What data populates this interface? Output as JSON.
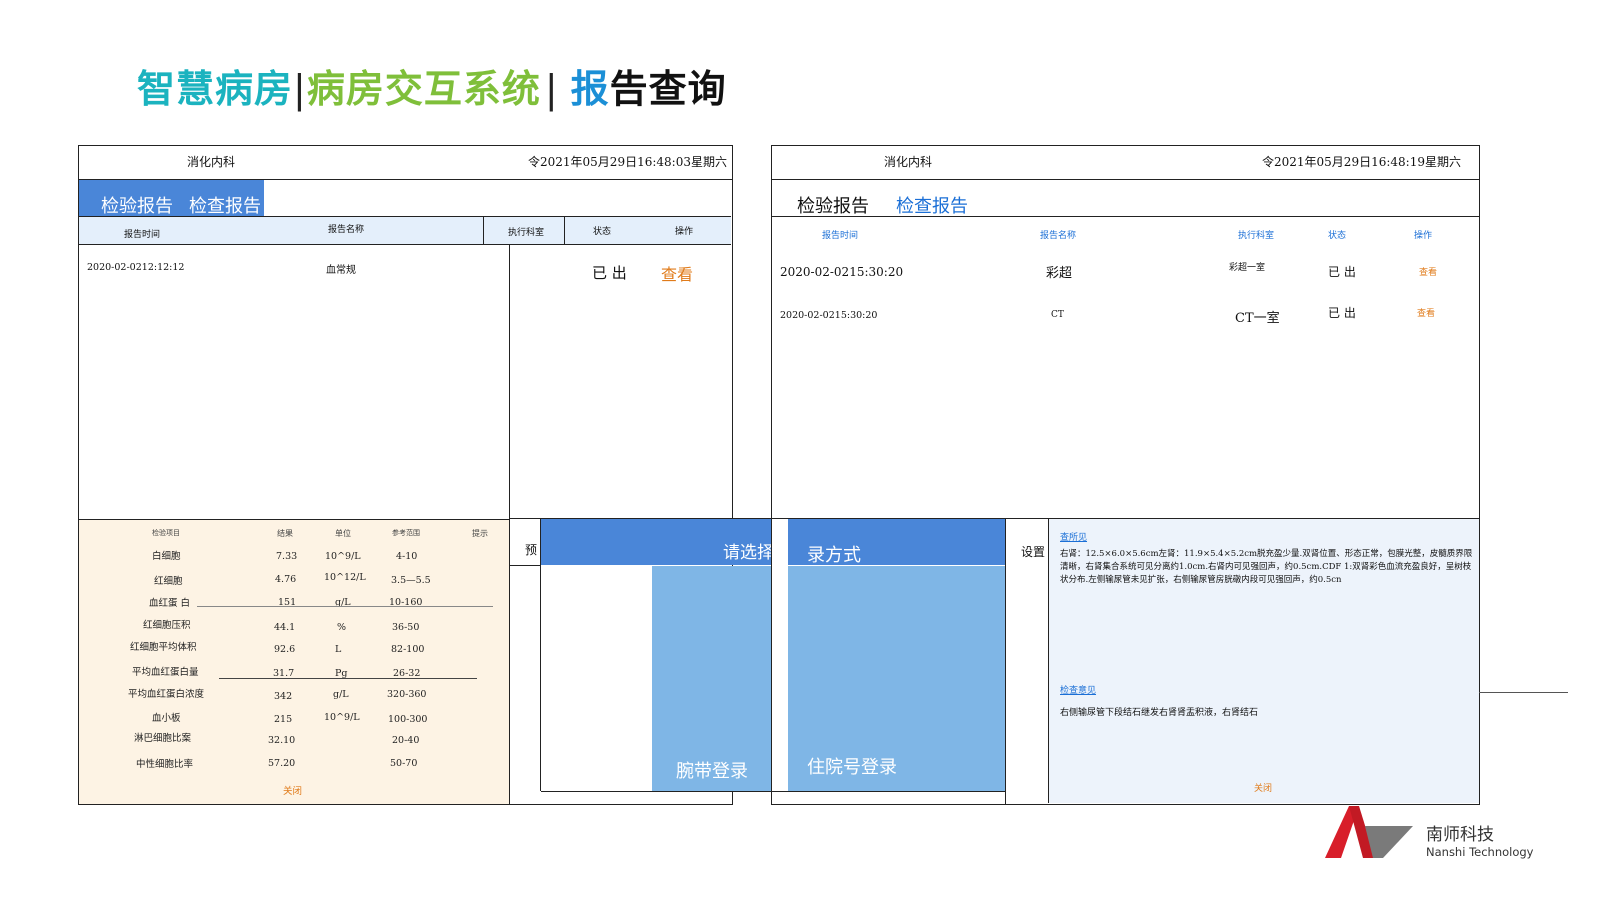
{
  "page_title": {
    "part1": "智慧病房",
    "sep1": "|",
    "part2": "病房交互系统",
    "sep2": "|",
    "part3a": "报",
    "part3b": "告查询"
  },
  "left_panel": {
    "department": "消化内科",
    "datetime": "令2021年05月29日16:48:03星期六",
    "tabs": {
      "tab1": "检验报告",
      "tab2": "检查报告"
    },
    "columns": {
      "time": "报告时间",
      "name": "报告名称",
      "dept": "执行科室",
      "status": "状态",
      "action": "操作"
    },
    "row": {
      "time": "2020-02-0212:12:12",
      "name": "血常规",
      "status": "已 出",
      "action": "查看"
    }
  },
  "lab_detail": {
    "headers": {
      "item": "检验项目",
      "result": "结果",
      "unit": "单位",
      "ref": "参考范围",
      "hint": "提示"
    },
    "rows": [
      {
        "item": "白细胞",
        "result": "7.33",
        "unit": "10^9/L",
        "ref": "4-10"
      },
      {
        "item": "红细胞",
        "result": "4.76",
        "unit": "10^12/L",
        "ref": "3.5—5.5"
      },
      {
        "item": "血红蛋 白",
        "result": "151",
        "unit": "g/L",
        "ref": "10-160"
      },
      {
        "item": "红细胞压积",
        "result": "44.1",
        "unit": "%",
        "ref": "36-50"
      },
      {
        "item": "红细胞平均体积",
        "result": "92.6",
        "unit": "L",
        "ref": "82-100"
      },
      {
        "item": "平均血红蛋白量",
        "result": "31.7",
        "unit": "Pg",
        "ref": "26-32"
      },
      {
        "item": "平均血红蛋白浓度",
        "result": "342",
        "unit": "g/L",
        "ref": "320-360"
      },
      {
        "item": "血小板",
        "result": "215",
        "unit": "10^9/L",
        "ref": "100-300"
      },
      {
        "item": "淋巴细胞比案",
        "result": "32.10",
        "unit": "",
        "ref": "20-40"
      },
      {
        "item": "中性细胞比率",
        "result": "57.20",
        "unit": "",
        "ref": "50-70"
      }
    ],
    "close": "关闭"
  },
  "login": {
    "pre_label": "预",
    "title_left": "请选择登",
    "title_right": "录方式",
    "wristband": "腕带登录",
    "admission": "住院号登录",
    "settings": "设置"
  },
  "right_panel": {
    "department": "消化内科",
    "datetime": "令2021年05月29日16:48:19星期六",
    "tabs": {
      "tab1": "检验报告",
      "tab2": "检查报告"
    },
    "columns": {
      "time": "报告时间",
      "name": "报告名称",
      "dept": "执行科室",
      "status": "状态",
      "action": "操作"
    },
    "rows": [
      {
        "time": "2020-02-0215:30:20",
        "name": "彩超",
        "dept": "彩超一室",
        "status": "已 出",
        "action": "查看"
      },
      {
        "time": "2020-02-0215:30:20",
        "name": "CT",
        "dept": "CT一室",
        "status": "已 出",
        "action": "查看"
      }
    ]
  },
  "exam_detail": {
    "findings_label": "查所见",
    "findings_text": "右肾：12.5×6.0×5.6cm左肾：11.9×5.4×5.2cm脱充盈少量.双肾位置、形态正常，包膜光整，皮髓质界限清晰，右肾集合系统可见分离约1.0cm.右肾内可见强回声，约0.5cm.CDF 1:双肾彩色血流充盈良好，呈树枝状分布.左侧输尿管未见扩张，右侧输尿管房胱礅内段可见强回声，约0.5cn",
    "opinion_label": "检查意见",
    "opinion_text": "右侧输尿管下段结石继发右肾肾盂积液，右肾结石",
    "close": "关闭"
  },
  "logo": {
    "cn": "南师科技",
    "en": "Nanshi Technology"
  },
  "colors": {
    "tab_blue": "#4a86d8",
    "login_panel": "#7fb6e6",
    "lab_bg": "#fdf3e4",
    "exam_bg": "#edf3fb",
    "action_orange": "#e07b1a"
  }
}
